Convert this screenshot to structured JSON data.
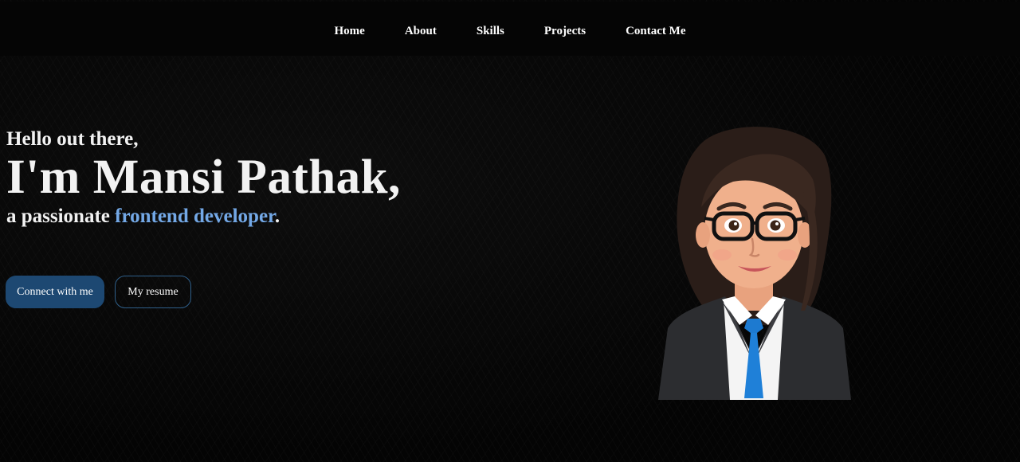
{
  "nav": {
    "items": [
      {
        "label": "Home"
      },
      {
        "label": "About"
      },
      {
        "label": "Skills"
      },
      {
        "label": "Projects"
      },
      {
        "label": "Contact Me"
      }
    ]
  },
  "hero": {
    "greeting": "Hello out there,",
    "name": "I'm Mansi Pathak,",
    "tagline_prefix": "a passionate ",
    "tagline_accent": "frontend developer",
    "tagline_suffix": "."
  },
  "buttons": {
    "connect": "Connect with me",
    "resume": "My resume"
  },
  "avatar": {
    "icon": "woman-developer-avatar"
  },
  "colors": {
    "background": "#050505",
    "accent": "#73a8e6",
    "primary_button": "#1d4872",
    "outline_border": "#2f5f8a",
    "text": "#ffffff"
  }
}
